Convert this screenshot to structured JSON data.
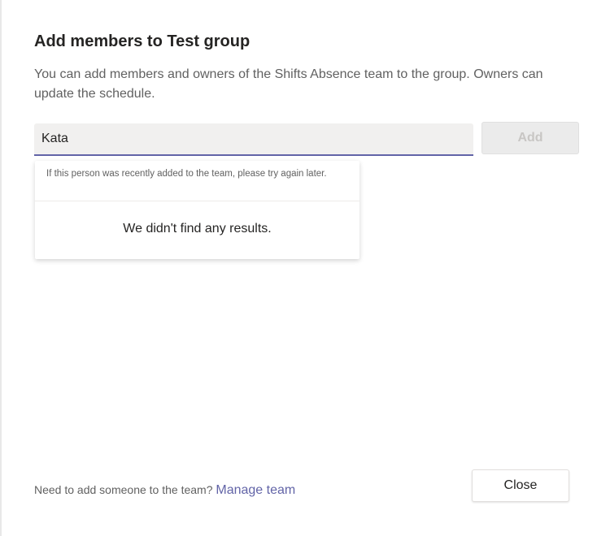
{
  "dialog": {
    "title": "Add members to Test group",
    "description": "You can add members and owners of the Shifts Absence team to the group. Owners can update the schedule."
  },
  "search": {
    "value": "Kata",
    "placeholder": ""
  },
  "add_button": {
    "label": "Add",
    "disabled": true
  },
  "dropdown": {
    "hint": "If this person was recently added to the team, please try again later.",
    "no_results": "We didn't find any results."
  },
  "footer": {
    "prompt": "Need to add someone to the team?",
    "link": "Manage team",
    "close_label": "Close"
  },
  "colors": {
    "accent": "#6264a7"
  }
}
